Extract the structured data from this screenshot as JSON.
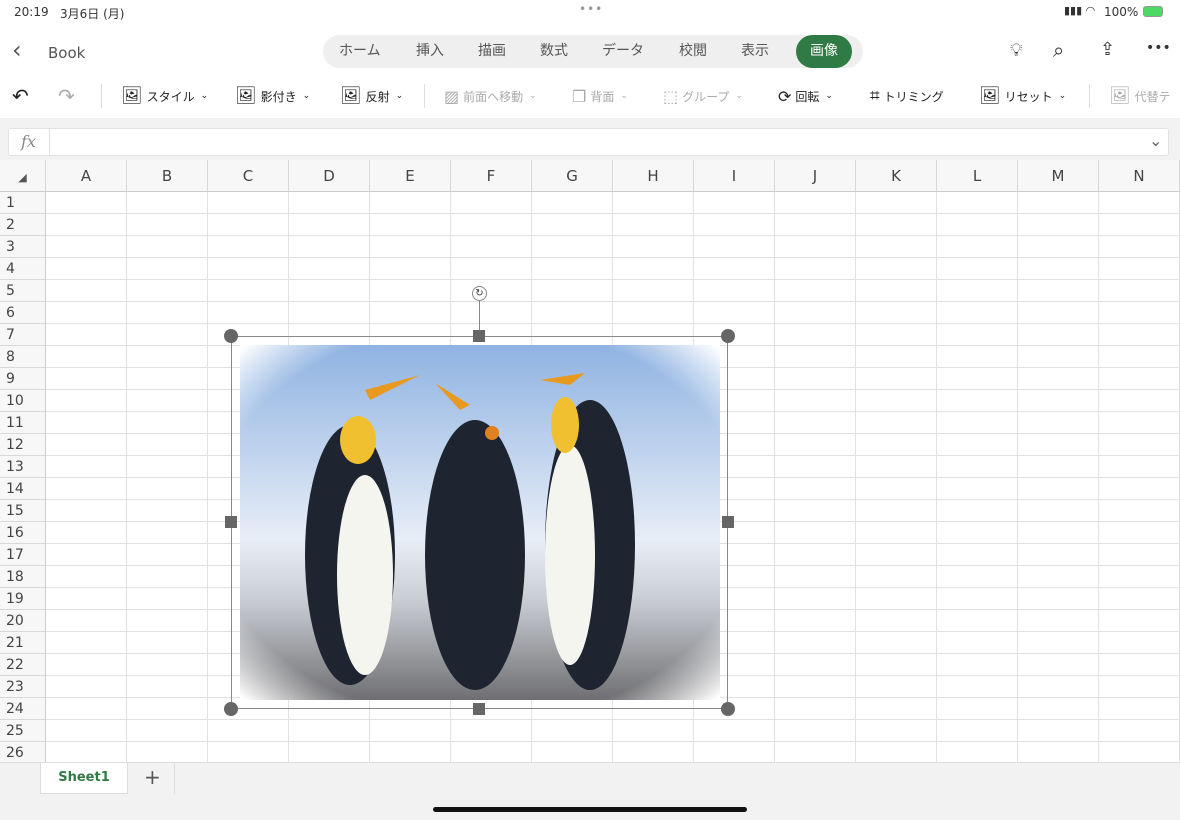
{
  "status": {
    "time": "20:19",
    "date": "3月6日 (月)",
    "battery": "100%"
  },
  "header": {
    "title": "Book",
    "tabs": [
      "ホーム",
      "挿入",
      "描画",
      "数式",
      "データ",
      "校閲",
      "表示",
      "画像"
    ],
    "active_tab": "画像",
    "accent": "#2f7a45"
  },
  "toolbar": {
    "style": "スタイル",
    "shadow": "影付き",
    "reflection": "反射",
    "bring_forward": "前面へ移動",
    "send_backward": "背面",
    "group": "グループ",
    "rotate": "回転",
    "crop": "トリミング",
    "reset": "リセット",
    "alt_text": "代替テ"
  },
  "formula": {
    "fx": "fx",
    "value": ""
  },
  "columns": [
    "A",
    "B",
    "C",
    "D",
    "E",
    "F",
    "G",
    "H",
    "I",
    "J",
    "K",
    "L",
    "M",
    "N"
  ],
  "rows": [
    1,
    2,
    3,
    4,
    5,
    6,
    7,
    8,
    9,
    10,
    11,
    12,
    13,
    14,
    15,
    16,
    17,
    18,
    19,
    20,
    21,
    22,
    23,
    24,
    25,
    26
  ],
  "sheets": {
    "tabs": [
      "Sheet1"
    ],
    "add": "+"
  }
}
